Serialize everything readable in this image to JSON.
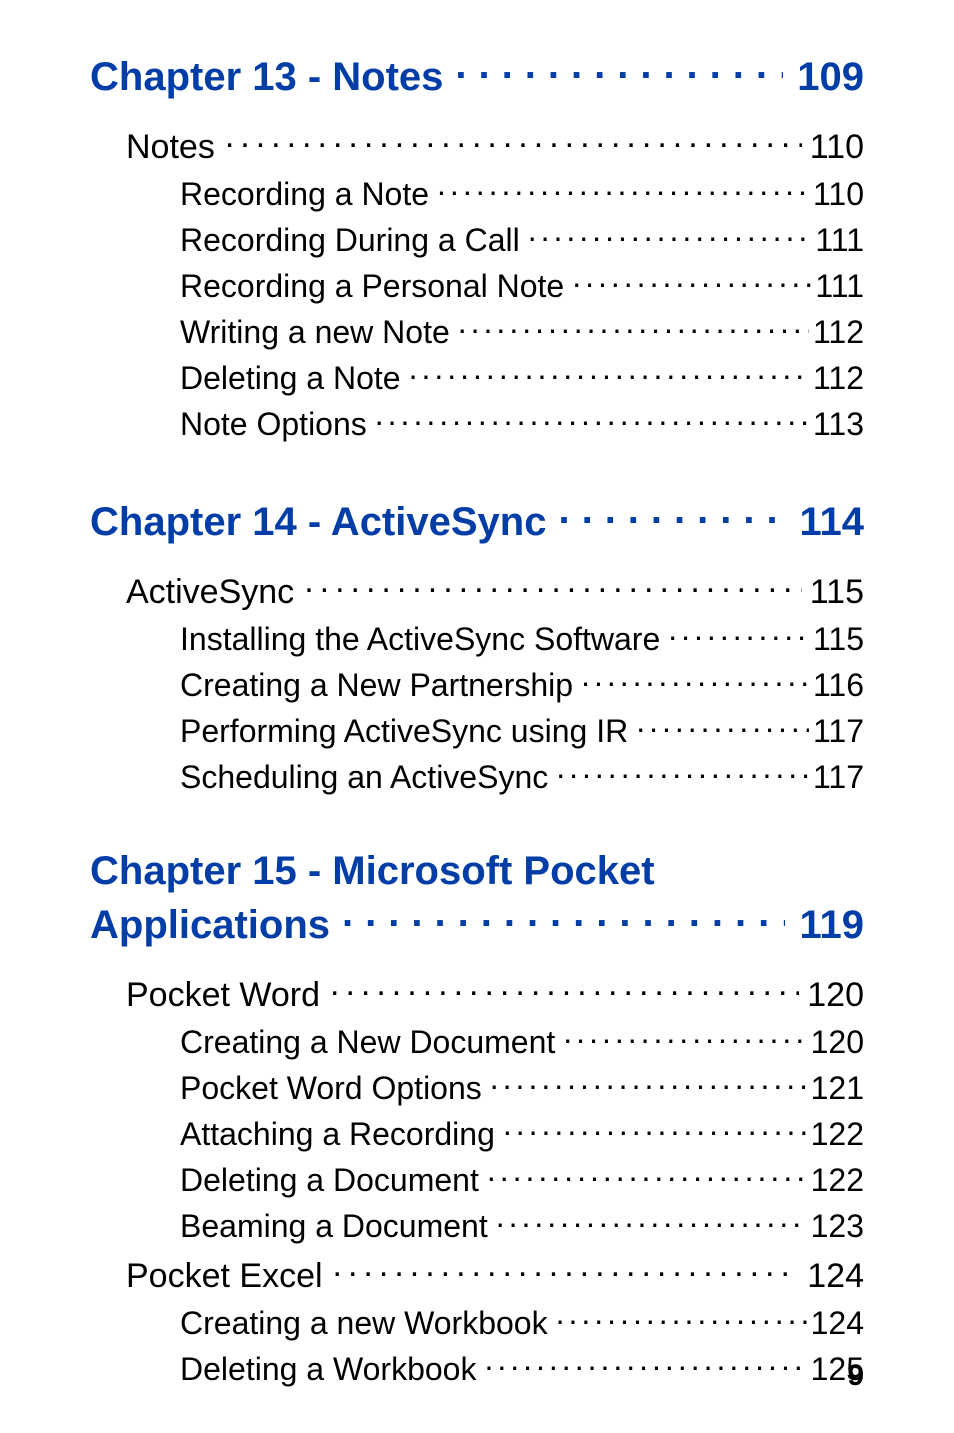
{
  "chapters": [
    {
      "title": "Chapter 13 - Notes",
      "page": "109",
      "sections": [
        {
          "title": "Notes",
          "page": "110",
          "subs": [
            {
              "title": "Recording a Note",
              "page": "110"
            },
            {
              "title": "Recording During a Call",
              "page": "111"
            },
            {
              "title": "Recording a Personal Note",
              "page": "111"
            },
            {
              "title": "Writing a new Note",
              "page": "112"
            },
            {
              "title": "Deleting a Note",
              "page": "112"
            },
            {
              "title": "Note Options",
              "page": "113"
            }
          ]
        }
      ]
    },
    {
      "title": "Chapter 14 - ActiveSync",
      "page": "114",
      "sections": [
        {
          "title": "ActiveSync",
          "page": "115",
          "subs": [
            {
              "title": "Installing the ActiveSync Software",
              "page": "115"
            },
            {
              "title": "Creating a New Partnership",
              "page": "116"
            },
            {
              "title": "Performing ActiveSync using IR",
              "page": "117"
            },
            {
              "title": "Scheduling an ActiveSync",
              "page": "117"
            }
          ]
        }
      ]
    },
    {
      "title_line1": "Chapter 15 - Microsoft Pocket",
      "title_line2": "Applications",
      "page": "119",
      "sections": [
        {
          "title": "Pocket Word",
          "page": "120",
          "subs": [
            {
              "title": "Creating a New Document",
              "page": "120"
            },
            {
              "title": "Pocket Word Options",
              "page": "121"
            },
            {
              "title": "Attaching a Recording",
              "page": "122"
            },
            {
              "title": "Deleting a Document",
              "page": "122"
            },
            {
              "title": "Beaming a Document",
              "page": "123"
            }
          ]
        },
        {
          "title": "Pocket Excel",
          "page": "124",
          "subs": [
            {
              "title": "Creating a new Workbook",
              "page": "124"
            },
            {
              "title": "Deleting a Workbook",
              "page": "125"
            }
          ]
        }
      ]
    }
  ],
  "footer_page": "9"
}
